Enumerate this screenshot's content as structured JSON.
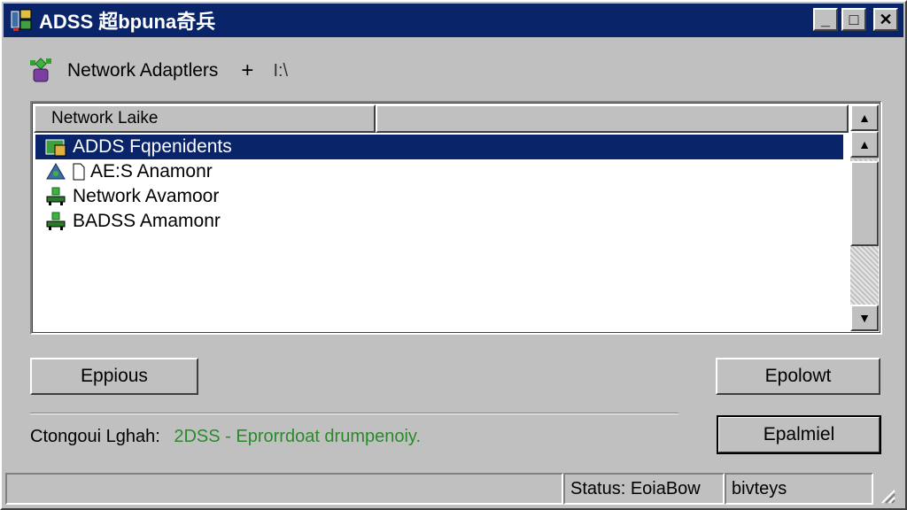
{
  "window": {
    "title": "ADSS 超bpuna奇兵",
    "minimize_glyph": "_",
    "maximize_glyph": "□",
    "close_glyph": "✕"
  },
  "heading": {
    "icon": "network-adapter-icon",
    "label": "Network Adaptlers",
    "plus": "+",
    "extra": "I:\\"
  },
  "list": {
    "columns": [
      "Network Laike",
      ""
    ],
    "rows": [
      {
        "label": "ADDS Fqpenidents",
        "icon": "folder-network-icon",
        "selected": true
      },
      {
        "label": "AE:S Anamonr",
        "icon": "network-tree-icon",
        "has_doc_icon": true,
        "selected": false
      },
      {
        "label": "Network Avamoor",
        "icon": "network-adapter-icon",
        "selected": false
      },
      {
        "label": "BADSS Amamonr",
        "icon": "network-adapter-icon",
        "selected": false
      }
    ],
    "scroll_up_glyph": "▲",
    "scroll_down_glyph": "▼"
  },
  "buttons": {
    "left": "Eppious",
    "right_top": "Epolowt",
    "right_bottom": "Epalmiel"
  },
  "connection": {
    "label": "Ctongoui Lghah:",
    "value": "2DSS - Eprorrdoat drumpenoiy."
  },
  "statusbar": {
    "main": "",
    "status": "Status:  EoiaBow",
    "extra": "bivteys"
  },
  "colors": {
    "titlebar": "#0a246a",
    "selection": "#0a246a",
    "face": "#c0c0c0",
    "accent_green": "#2a8a2a"
  }
}
